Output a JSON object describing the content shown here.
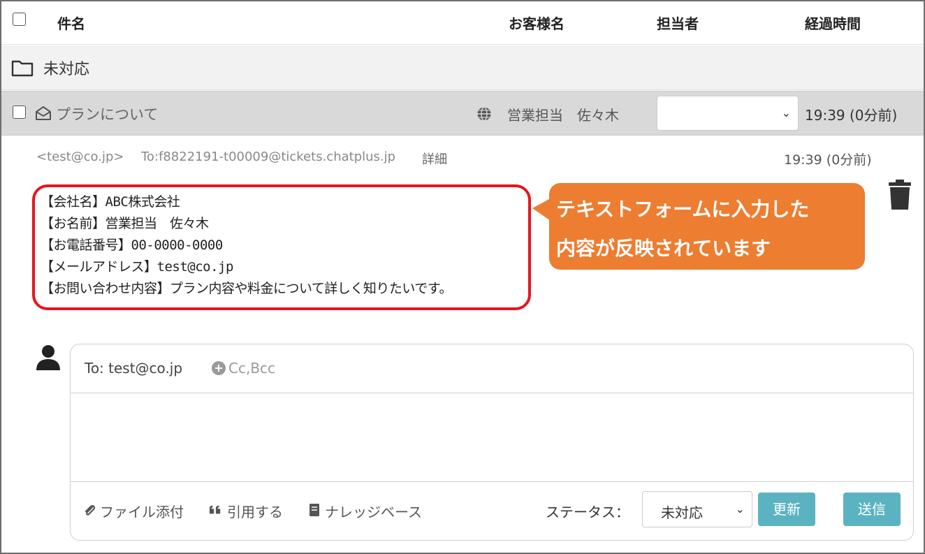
{
  "header": {
    "subject": "件名",
    "customer": "お客様名",
    "assignee": "担当者",
    "elapsed": "経過時間"
  },
  "group": {
    "label": "未対応"
  },
  "ticket": {
    "subject": "プランについて",
    "customer": "営業担当　佐々木",
    "assignee_value": "",
    "time": "19:39 (0分前)"
  },
  "message": {
    "from": "<test@co.jp>",
    "to": "To:f8822191-t00009@tickets.chatplus.jp",
    "detail_link": "詳細",
    "time": "19:39 (0分前)",
    "lines": [
      "【会社名】ABC株式会社",
      "【お名前】営業担当　佐々木",
      "【お電話番号】00-0000-0000",
      "【メールアドレス】test@co.jp",
      "【お問い合わせ内容】プラン内容や料金について詳しく知りたいです。"
    ]
  },
  "callout": {
    "line1": "テキストフォームに入力した",
    "line2": "内容が反映されています"
  },
  "composer": {
    "to": "To: test@co.jp",
    "cc_bcc": "Cc,Bcc",
    "reply_value": "",
    "attach": "ファイル添付",
    "quote": "引用する",
    "knowledge": "ナレッジベース",
    "status_label": "ステータス：",
    "status_value": "未対応",
    "update_button": "更新",
    "send_button": "送信"
  },
  "colors": {
    "highlight_border": "#e8141e",
    "callout_bg": "#ed7d31",
    "button_bg": "#5bb3c1",
    "ticket_row_bg": "#d9d9d9"
  },
  "icons": [
    "folder-icon",
    "mail-open-icon",
    "globe-icon",
    "trash-icon",
    "avatar-icon",
    "plus-circle-icon",
    "paperclip-icon",
    "quote-icon",
    "book-icon",
    "chevron-down-icon"
  ]
}
